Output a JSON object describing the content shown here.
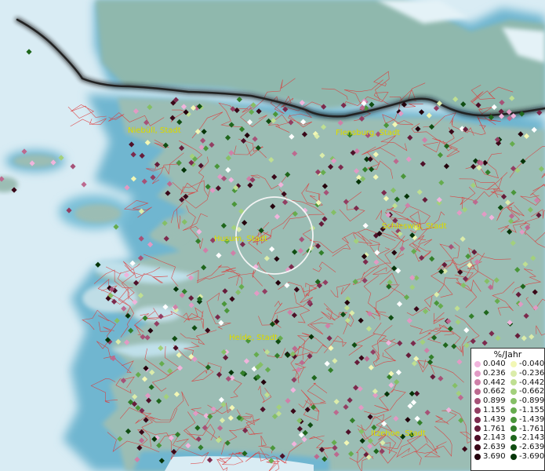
{
  "cities": [
    {
      "name": "Niebüll, Stadt"
    },
    {
      "name": "Flensburg, Stadt"
    },
    {
      "name": "Husum, Stadt"
    },
    {
      "name": "Schleswig, Stadt"
    },
    {
      "name": "Heide, Stadt"
    },
    {
      "name": "Itzehoe, Stadt"
    }
  ],
  "legend": {
    "title": "%/Jahr",
    "positive": [
      "0.040",
      "0.236",
      "0.442",
      "0.662",
      "0.899",
      "1.155",
      "1.439",
      "1.761",
      "2.143",
      "2.639",
      "3.690"
    ],
    "negative": [
      "-0.040",
      "-0.236",
      "-0.442",
      "-0.662",
      "-0.899",
      "-1.155",
      "-1.439",
      "-1.761",
      "-2.143",
      "-2.639",
      "-3.690"
    ],
    "positive_colors": [
      "#f0b4dc",
      "#e19ac4",
      "#cf80a8",
      "#bc6a8f",
      "#a65277",
      "#923e62",
      "#7c2a4d",
      "#661c3a",
      "#4e1028",
      "#3a0818",
      "#24020c"
    ],
    "negative_colors": [
      "#f2f7b5",
      "#dbecaa",
      "#bfdf92",
      "#a3d07c",
      "#85bf66",
      "#66ac4e",
      "#4a963a",
      "#337f2a",
      "#1f661c",
      "#104d12",
      "#053408"
    ]
  },
  "colors": {
    "water": "#d9ecf4",
    "shallow_water": "#7fbfd6",
    "land": "#9bbdb4",
    "border": "#e03535",
    "national_border": "#1e1e1e",
    "label": "#e6e600"
  }
}
